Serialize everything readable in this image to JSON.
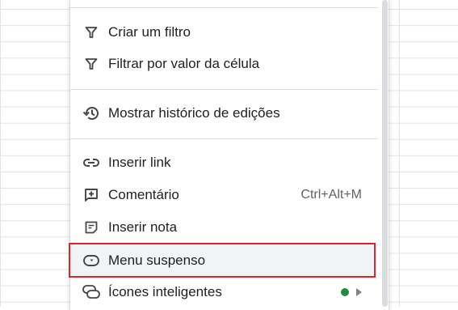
{
  "menu": {
    "items": [
      {
        "label": "Criar um filtro",
        "icon": "filter-icon"
      },
      {
        "label": "Filtrar por valor da célula",
        "icon": "filter-icon"
      },
      {
        "label": "Mostrar histórico de edições",
        "icon": "history-icon"
      },
      {
        "label": "Inserir link",
        "icon": "link-icon"
      },
      {
        "label": "Comentário",
        "icon": "add-comment-icon",
        "shortcut": "Ctrl+Alt+M"
      },
      {
        "label": "Inserir nota",
        "icon": "note-icon"
      },
      {
        "label": "Menu suspenso",
        "icon": "dropdown-icon",
        "highlighted": true
      },
      {
        "label": "Ícones inteligentes",
        "icon": "smart-chip-icon",
        "badge_color": "#1e8e3e"
      }
    ]
  },
  "colors": {
    "highlight_border": "#d9252c",
    "text": "#202124",
    "new_badge": "#1e8e3e"
  }
}
